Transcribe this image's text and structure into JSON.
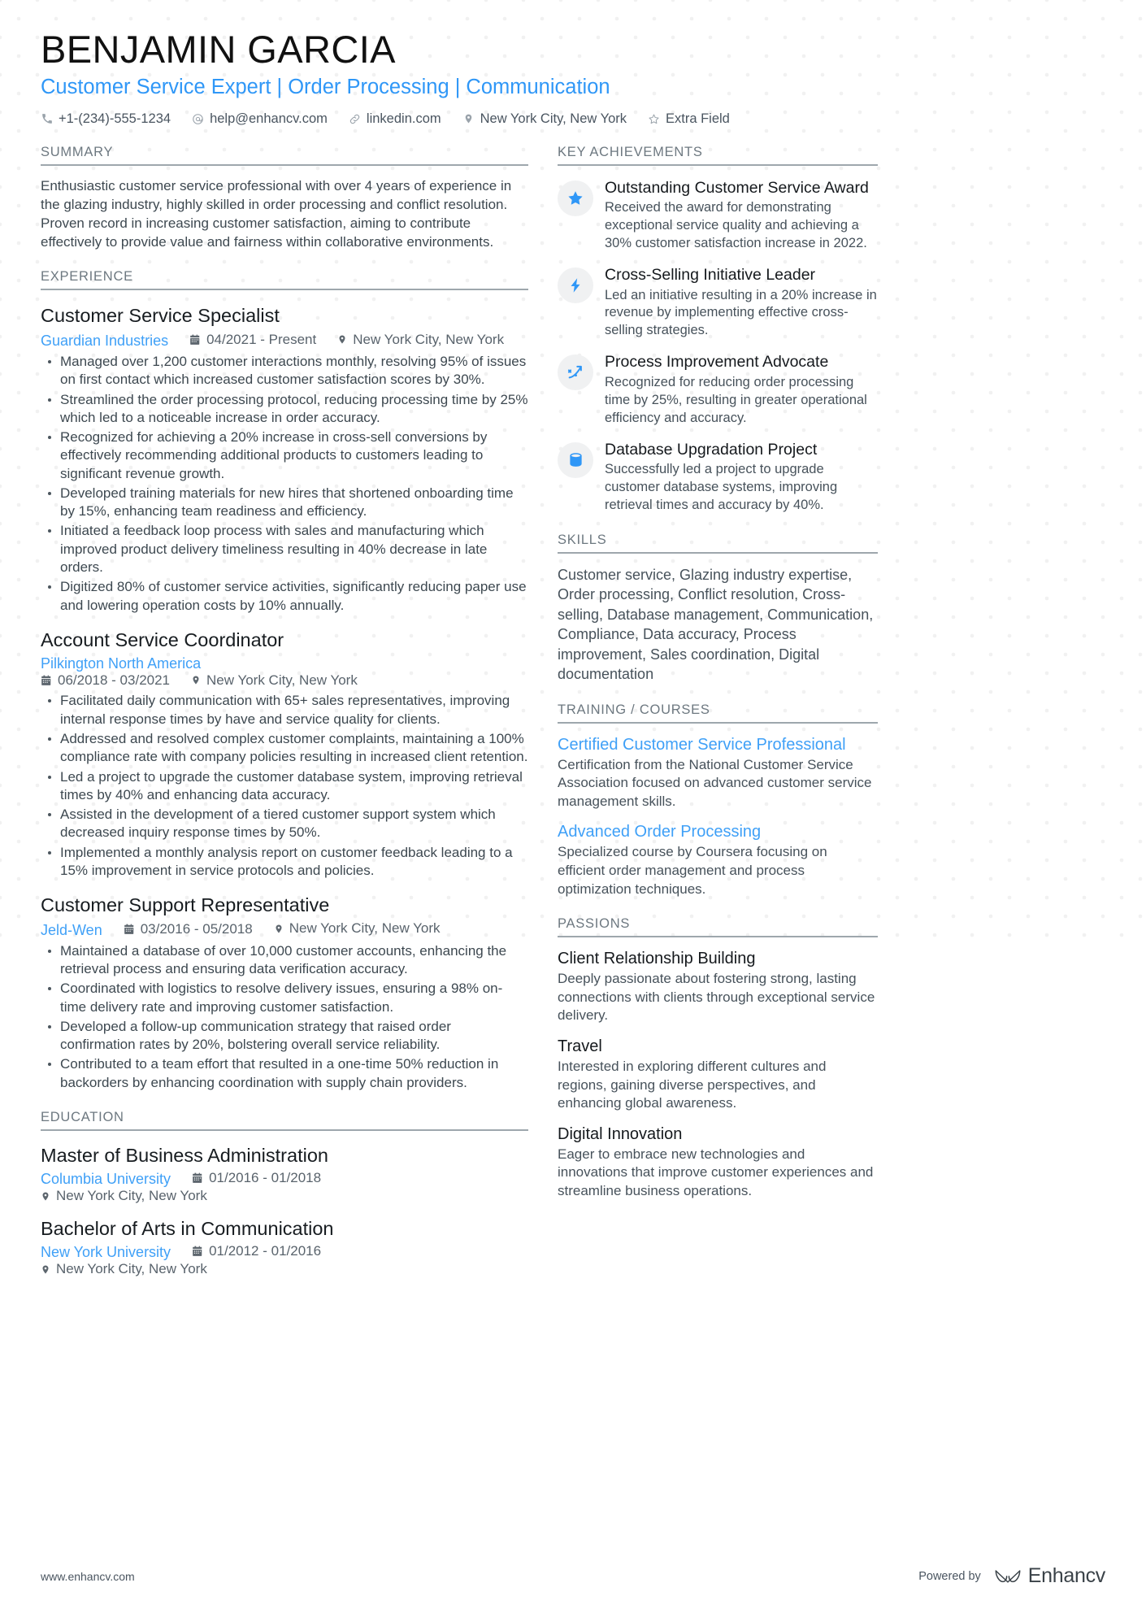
{
  "header": {
    "name": "BENJAMIN GARCIA",
    "headline": "Customer Service Expert | Order Processing | Communication",
    "contacts": [
      {
        "icon": "phone-icon",
        "text": "+1-(234)-555-1234"
      },
      {
        "icon": "email-icon",
        "text": "help@enhancv.com"
      },
      {
        "icon": "link-icon",
        "text": "linkedin.com"
      },
      {
        "icon": "location-pin-icon",
        "text": "New York City, New York"
      },
      {
        "icon": "star-outline-icon",
        "text": "Extra Field"
      }
    ]
  },
  "left": {
    "summary": {
      "title": "SUMMARY",
      "text": "Enthusiastic customer service professional with over 4 years of experience in the glazing industry, highly skilled in order processing and conflict resolution. Proven record in increasing customer satisfaction, aiming to contribute effectively to provide value and fairness within collaborative environments."
    },
    "experience": {
      "title": "EXPERIENCE",
      "jobs": [
        {
          "role": "Customer Service Specialist",
          "company": "Guardian Industries",
          "dates": "04/2021 - Present",
          "location": "New York City, New York",
          "stacked": false,
          "bullets": [
            "Managed over 1,200 customer interactions monthly, resolving 95% of issues on first contact which increased customer satisfaction scores by 30%.",
            "Streamlined the order processing protocol, reducing processing time by 25% which led to a noticeable increase in order accuracy.",
            "Recognized for achieving a 20% increase in cross-sell conversions by effectively recommending additional products to customers leading to significant revenue growth.",
            "Developed training materials for new hires that shortened onboarding time by 15%, enhancing team readiness and efficiency.",
            "Initiated a feedback loop process with sales and manufacturing which improved product delivery timeliness resulting in 40% decrease in late orders.",
            "Digitized 80% of customer service activities, significantly reducing paper use and lowering operation costs by 10% annually."
          ]
        },
        {
          "role": "Account Service Coordinator",
          "company": "Pilkington North America",
          "dates": "06/2018 - 03/2021",
          "location": "New York City, New York",
          "stacked": true,
          "bullets": [
            "Facilitated daily communication with 65+ sales representatives, improving internal response times by have and service quality for clients.",
            "Addressed and resolved complex customer complaints, maintaining a 100% compliance rate with company policies resulting in increased client retention.",
            "Led a project to upgrade the customer database system, improving retrieval times by 40% and enhancing data accuracy.",
            "Assisted in the development of a tiered customer support system which decreased inquiry response times by 50%.",
            "Implemented a monthly analysis report on customer feedback leading to a 15% improvement in service protocols and policies."
          ]
        },
        {
          "role": "Customer Support Representative",
          "company": "Jeld-Wen",
          "dates": "03/2016 - 05/2018",
          "location": "New York City, New York",
          "stacked": false,
          "bullets": [
            "Maintained a database of over 10,000 customer accounts, enhancing the retrieval process and ensuring data verification accuracy.",
            "Coordinated with logistics to resolve delivery issues, ensuring a 98% on-time delivery rate and improving customer satisfaction.",
            "Developed a follow-up communication strategy that raised order confirmation rates by 20%, bolstering overall service reliability.",
            "Contributed to a team effort that resulted in a one-time 50% reduction in backorders by enhancing coordination with supply chain providers."
          ]
        }
      ]
    },
    "education": {
      "title": "EDUCATION",
      "entries": [
        {
          "degree": "Master of Business Administration",
          "school": "Columbia University",
          "dates": "01/2016 - 01/2018",
          "location": "New York City, New York"
        },
        {
          "degree": "Bachelor of Arts in Communication",
          "school": "New York University",
          "dates": "01/2012 - 01/2016",
          "location": "New York City, New York"
        }
      ]
    }
  },
  "right": {
    "achievements": {
      "title": "KEY ACHIEVEMENTS",
      "items": [
        {
          "icon": "star-icon",
          "title": "Outstanding Customer Service Award",
          "desc": "Received the award for demonstrating exceptional service quality and achieving a 30% customer satisfaction increase in 2022."
        },
        {
          "icon": "lightning-bolt-icon",
          "title": "Cross-Selling Initiative Leader",
          "desc": "Led an initiative resulting in a 20% increase in revenue by implementing effective cross-selling strategies."
        },
        {
          "icon": "trend-arrow-icon",
          "title": "Process Improvement Advocate",
          "desc": "Recognized for reducing order processing time by 25%, resulting in greater operational efficiency and accuracy."
        },
        {
          "icon": "database-icon",
          "title": "Database Upgradation Project",
          "desc": "Successfully led a project to upgrade customer database systems, improving retrieval times and accuracy by 40%."
        }
      ]
    },
    "skills": {
      "title": "SKILLS",
      "text": "Customer service, Glazing industry expertise, Order processing, Conflict resolution, Cross-selling, Database management, Communication, Compliance, Data accuracy, Process improvement, Sales coordination, Digital documentation"
    },
    "training": {
      "title": "TRAINING / COURSES",
      "items": [
        {
          "title": "Certified Customer Service Professional",
          "desc": "Certification from the National Customer Service Association focused on advanced customer service management skills."
        },
        {
          "title": "Advanced Order Processing",
          "desc": "Specialized course by Coursera focusing on efficient order management and process optimization techniques."
        }
      ]
    },
    "passions": {
      "title": "PASSIONS",
      "items": [
        {
          "title": "Client Relationship Building",
          "desc": "Deeply passionate about fostering strong, lasting connections with clients through exceptional service delivery."
        },
        {
          "title": "Travel",
          "desc": "Interested in exploring different cultures and regions, gaining diverse perspectives, and enhancing global awareness."
        },
        {
          "title": "Digital Innovation",
          "desc": "Eager to embrace new technologies and innovations that improve customer experiences and streamline business operations."
        }
      ]
    }
  },
  "footer": {
    "url": "www.enhancv.com",
    "powered_by": "Powered by",
    "brand": "Enhancv"
  },
  "colors": {
    "accent": "#2f97f7",
    "link": "#3fa0f7",
    "rule": "#9ea7ad",
    "text": "#3d4850"
  }
}
